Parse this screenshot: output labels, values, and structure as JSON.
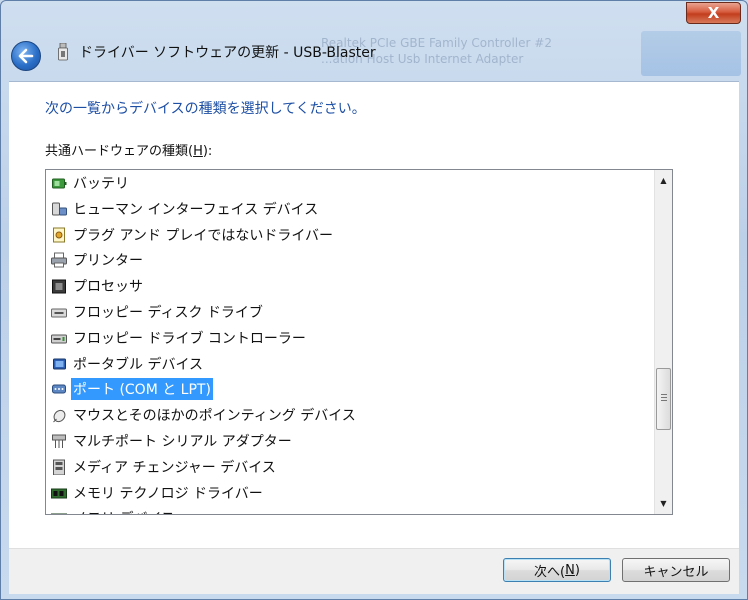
{
  "window": {
    "title": "ドライバー ソフトウェアの更新 - USB-Blaster",
    "close_glyph": "X",
    "background_text": [
      "Realtek PCIe GBE Family Controller #2",
      "...ation Host Usb Internet Adapter"
    ]
  },
  "content": {
    "instruction": "次の一覧からデバイスの種類を選択してください。",
    "list_label_prefix": "共通ハードウェアの種類(",
    "list_label_hotkey": "H",
    "list_label_suffix": "):"
  },
  "hardware_types": [
    {
      "label": "バッテリ",
      "icon": "battery-icon"
    },
    {
      "label": "ヒューマン インターフェイス デバイス",
      "icon": "hid-icon"
    },
    {
      "label": "プラグ アンド プレイではないドライバー",
      "icon": "driver-icon"
    },
    {
      "label": "プリンター",
      "icon": "printer-icon"
    },
    {
      "label": "プロセッサ",
      "icon": "processor-icon"
    },
    {
      "label": "フロッピー ディスク ドライブ",
      "icon": "floppy-drive-icon"
    },
    {
      "label": "フロッピー ドライブ コントローラー",
      "icon": "floppy-controller-icon"
    },
    {
      "label": "ポータブル デバイス",
      "icon": "portable-device-icon"
    },
    {
      "label": "ポート (COM と LPT)",
      "icon": "port-icon",
      "selected": true
    },
    {
      "label": "マウスとそのほかのポインティング デバイス",
      "icon": "mouse-icon"
    },
    {
      "label": "マルチポート シリアル アダプター",
      "icon": "multiport-icon"
    },
    {
      "label": "メディア チェンジャー デバイス",
      "icon": "media-changer-icon"
    },
    {
      "label": "メモリ テクノロジ ドライバー",
      "icon": "memory-tech-icon"
    },
    {
      "label": "メモリ デバイス",
      "icon": "memory-device-icon"
    }
  ],
  "buttons": {
    "next_prefix": "次へ(",
    "next_hotkey": "N",
    "next_suffix": ")",
    "cancel": "キャンセル"
  },
  "colors": {
    "instruction": "#1d4fa5",
    "selection": "#3399ff",
    "close_button": "#c23d1d"
  }
}
